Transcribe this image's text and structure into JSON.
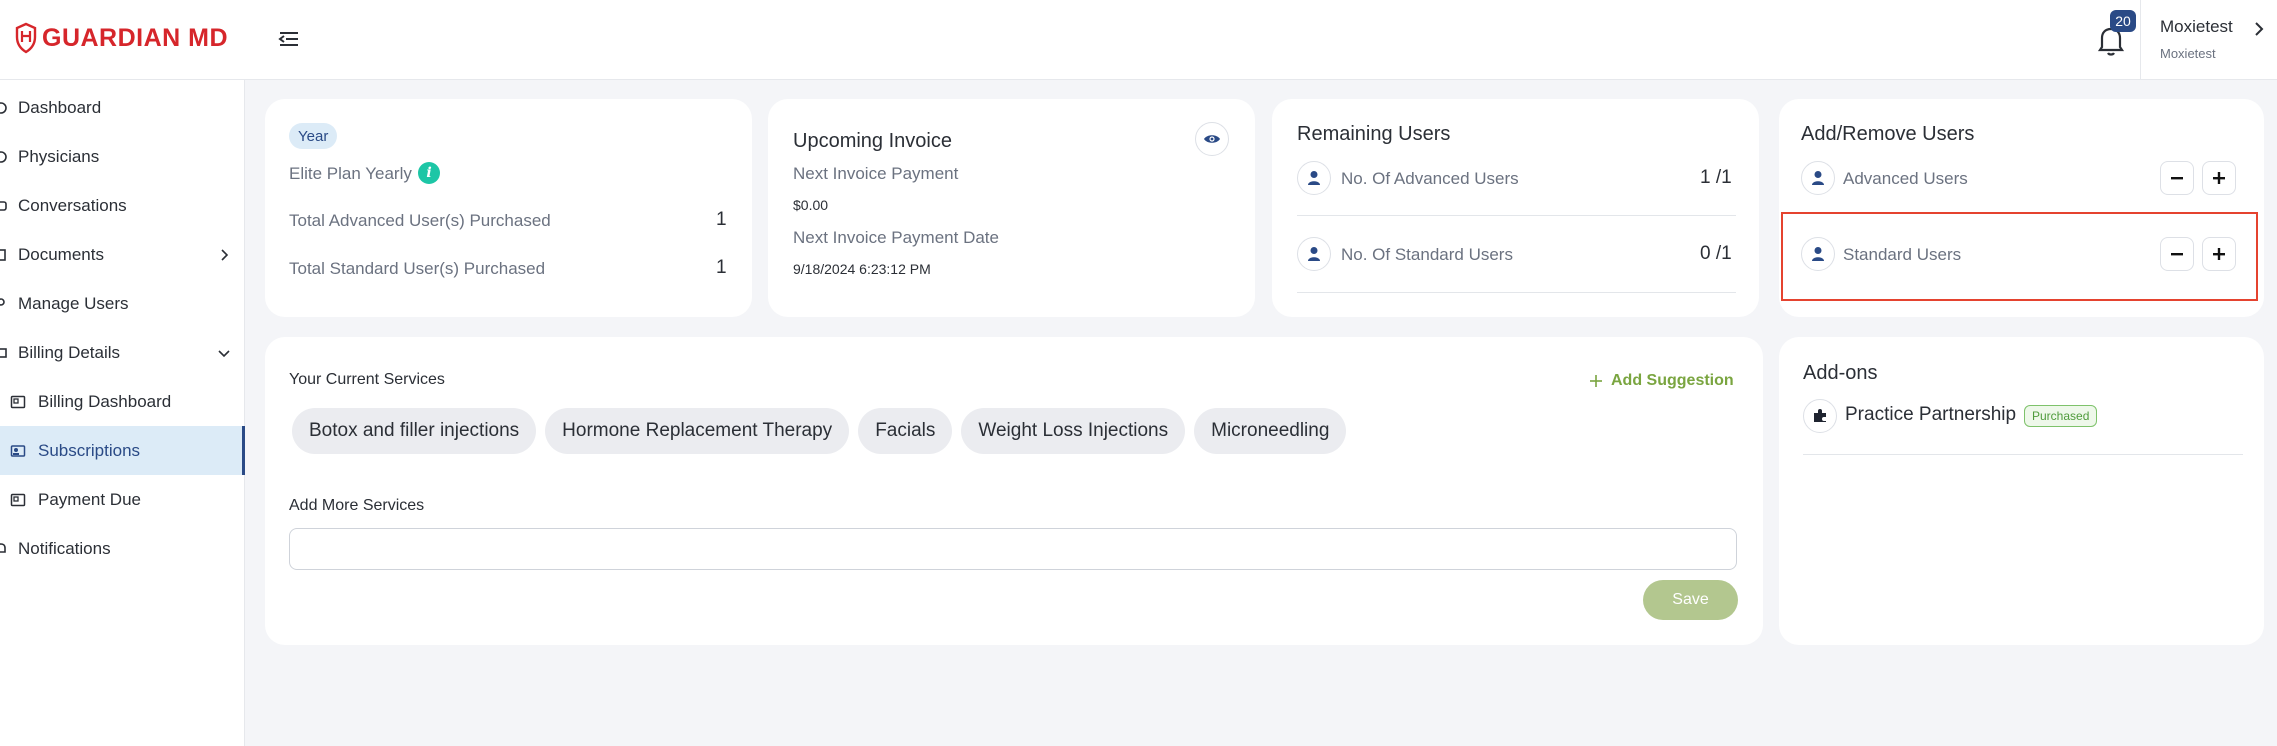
{
  "header": {
    "logo_text": "GUARDIAN MD",
    "notification_count": "20",
    "user_name": "Moxietest",
    "user_sub": "Moxietest"
  },
  "sidebar": {
    "items": [
      {
        "label": "Dashboard"
      },
      {
        "label": "Physicians"
      },
      {
        "label": "Conversations"
      },
      {
        "label": "Documents"
      },
      {
        "label": "Manage Users"
      },
      {
        "label": "Billing Details"
      },
      {
        "label": "Billing Dashboard"
      },
      {
        "label": "Subscriptions"
      },
      {
        "label": "Payment Due"
      },
      {
        "label": "Notifications"
      }
    ],
    "active": "Subscriptions"
  },
  "plan": {
    "period": "Year",
    "plan_name": "Elite Plan Yearly",
    "advanced_label": "Total Advanced User(s) Purchased",
    "advanced_value": "1",
    "standard_label": "Total Standard User(s) Purchased",
    "standard_value": "1"
  },
  "invoice": {
    "title": "Upcoming Invoice",
    "next_payment_label": "Next Invoice Payment",
    "next_payment_value": "$0.00",
    "next_date_label": "Next Invoice Payment Date",
    "next_date_value": "9/18/2024 6:23:12 PM"
  },
  "remaining": {
    "title": "Remaining Users",
    "advanced_label": "No. Of Advanced Users",
    "advanced_value": "1 /1",
    "standard_label": "No. Of Standard Users",
    "standard_value": "0 /1"
  },
  "add_remove": {
    "title": "Add/Remove Users",
    "advanced_label": "Advanced Users",
    "standard_label": "Standard Users"
  },
  "services": {
    "title": "Your Current Services",
    "add_suggestion": "Add Suggestion",
    "chips": [
      "Botox and filler injections",
      "Hormone Replacement Therapy",
      "Facials",
      "Weight Loss Injections",
      "Microneedling"
    ],
    "add_more_label": "Add More Services",
    "input_value": "",
    "save_label": "Save"
  },
  "addons": {
    "title": "Add-ons",
    "items": [
      {
        "name": "Practice Partnership",
        "status": "Purchased"
      }
    ]
  },
  "colors": {
    "brand_red": "#d6262b",
    "accent_navy": "#2a4a86",
    "accent_green": "#7aa540",
    "highlight": "#e5432f"
  }
}
